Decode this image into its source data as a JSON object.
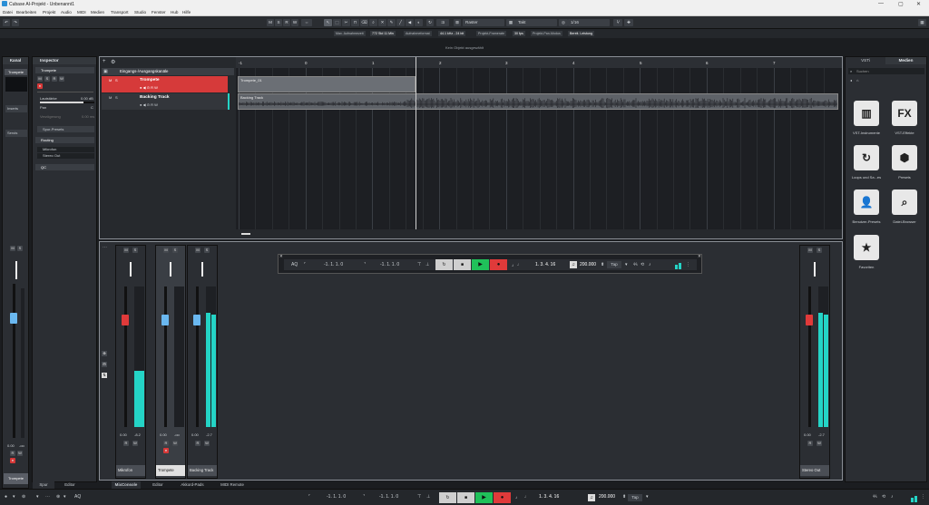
{
  "window": {
    "title": "Cubase AI-Projekt - Unbenannt1"
  },
  "menu": [
    "Datei",
    "Bearbeiten",
    "Projekt",
    "Audio",
    "MIDI",
    "Medien",
    "Transport",
    "Studio",
    "Fenster",
    "Hub",
    "Hilfe"
  ],
  "toolbar": {
    "mode_buttons": [
      "M",
      "S",
      "R",
      "W"
    ],
    "raster_label": "Raster",
    "takt_label": "Takt",
    "quantize": "1/16"
  },
  "infobar": {
    "max_record": "Max. Aufnahmezeit",
    "max_record_val": "772 Std 11 Min",
    "rec_format": "Aufnahmeformat",
    "rec_format_val": "44.1 kHz - 24 bit",
    "frame_rate": "Projekt-Framerate",
    "frame_rate_val": "30 fps",
    "pan_law": "Projekt-Pan-Modus",
    "pan_law_val": "Bereit. Leistung"
  },
  "status_text": "Kein Objekt ausgewählt",
  "left_zone": {
    "tab": "Kanal",
    "channel_name": "Trompete",
    "inserts": "Inserts",
    "sends": "Sends",
    "fader_value": "0.00",
    "fader_value2": "-oo",
    "footer": "Trompete",
    "tab_spur": "Spur",
    "tab_editor": "Editor"
  },
  "inspector": {
    "title": "Inspector",
    "track": "Trompete",
    "volume_label": "Lautstärke",
    "volume_val": "0.00 dB",
    "pan_label": "Pan",
    "pan_val": "C",
    "delay_label": "Verzögerung",
    "delay_val": "0.00 ms",
    "presets": "Spur-Presets",
    "routing": "Routing",
    "input": "Mikrofon",
    "output": "Stereo Out",
    "qc": "QC"
  },
  "tracks": {
    "folder": "Eingangs-/Ausgangskanäle",
    "track1": "Trompete",
    "track2": "Backing Track",
    "event1": "Trompete_01",
    "event2": "Backing Track"
  },
  "ruler": {
    "ticks": [
      "-1",
      "0",
      "1",
      "2",
      "3",
      "4",
      "5",
      "6",
      "7"
    ]
  },
  "mixer": {
    "channels": [
      {
        "name": "Mikrofon",
        "val": "0.00",
        "val2": "-8.2"
      },
      {
        "name": "Trompete",
        "val": "0.00",
        "val2": "-oo"
      },
      {
        "name": "Backing Track",
        "val": "0.00",
        "val2": "-2.7"
      }
    ],
    "out": {
      "name": "Stereo Out",
      "val": "0.00",
      "val2": "-2.7"
    }
  },
  "transport": {
    "left_locator": "-1. 1. 1.   0",
    "right_locator": "-1. 1. 1.   0",
    "position": "1. 3. 4. 16",
    "tempo": "200.000",
    "tap": "Tap",
    "aq": "AQ"
  },
  "right_zone": {
    "tab1": "VSTi",
    "tab2": "Medien",
    "search": "Suchen",
    "tiles": [
      {
        "label": "VST-Instrumente",
        "glyph": "▥"
      },
      {
        "label": "VST-Effekte",
        "glyph": "FX"
      },
      {
        "label": "Loops und Sa...es",
        "glyph": "↻"
      },
      {
        "label": "Presets",
        "glyph": "⬢"
      },
      {
        "label": "Benutzer-Presets",
        "glyph": "👤"
      },
      {
        "label": "Datei-Browser",
        "glyph": "⌕"
      },
      {
        "label": "Favoriten",
        "glyph": "★"
      }
    ]
  },
  "bottom_tabs": [
    "MixConsole",
    "Editor",
    "Akkord-Pads",
    "MIDI Remote"
  ],
  "bottom_transport": {
    "position": "1. 3. 4. 16",
    "tempo": "200.000",
    "tap": "Tap",
    "left": "-1. 1. 1.   0",
    "right": "-1. 1. 1.   0",
    "aq": "AQ"
  }
}
